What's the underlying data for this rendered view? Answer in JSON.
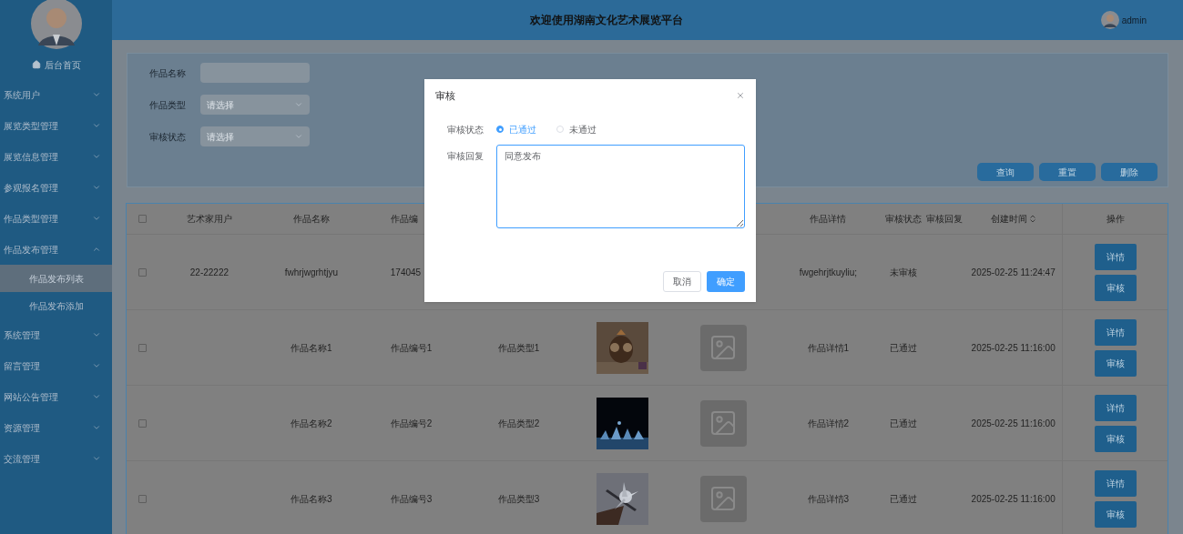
{
  "header": {
    "title": "欢迎使用湖南文化艺术展览平台",
    "user": "admin"
  },
  "sidebar": {
    "home": "后台首页",
    "items": [
      {
        "label": "系统用户",
        "expanded": false
      },
      {
        "label": "展览类型管理",
        "expanded": false
      },
      {
        "label": "展览信息管理",
        "expanded": false
      },
      {
        "label": "参观报名管理",
        "expanded": false
      },
      {
        "label": "作品类型管理",
        "expanded": false
      },
      {
        "label": "作品发布管理",
        "expanded": true,
        "children": [
          {
            "label": "作品发布列表",
            "selected": true
          },
          {
            "label": "作品发布添加",
            "selected": false
          }
        ]
      },
      {
        "label": "系统管理",
        "expanded": false
      },
      {
        "label": "留言管理",
        "expanded": false
      },
      {
        "label": "网站公告管理",
        "expanded": false
      },
      {
        "label": "资源管理",
        "expanded": false
      },
      {
        "label": "交流管理",
        "expanded": false
      }
    ]
  },
  "search": {
    "fields": [
      {
        "label": "作品名称",
        "kind": "text"
      },
      {
        "label": "作品类型",
        "kind": "select",
        "placeholder": "请选择"
      },
      {
        "label": "审核状态",
        "kind": "select",
        "placeholder": "请选择"
      }
    ],
    "buttons": [
      "查询",
      "重置",
      "删除"
    ]
  },
  "table": {
    "all_checked": false,
    "columns": [
      {
        "label": "艺术家用户"
      },
      {
        "label": "作品名称"
      },
      {
        "label": "作品编"
      },
      {},
      {},
      {},
      {
        "label": "作品详情"
      },
      {
        "label": "审核状态"
      },
      {
        "label": "审核回复"
      },
      {
        "label": "创建时间",
        "sortable": true
      },
      {
        "label": "操作"
      }
    ],
    "rows": [
      {
        "checked": false,
        "cells": [
          {
            "kind": "text",
            "text": "22-22222"
          },
          {
            "kind": "text",
            "text": "fwhrjwgrhtjyu"
          },
          {
            "kind": "text",
            "text": "174045"
          },
          {},
          {},
          {},
          {
            "kind": "text",
            "text": "fwgehrjtkuyliu;"
          },
          {
            "kind": "text",
            "text": "未审核"
          },
          {},
          {
            "kind": "text",
            "text": "2025-02-25 11:24:47"
          }
        ],
        "actions": [
          "详情",
          "审核"
        ]
      },
      {
        "checked": false,
        "cells": [
          {},
          {
            "kind": "text",
            "text": "作品名称1"
          },
          {
            "kind": "text",
            "text": "作品编号1"
          },
          {
            "kind": "text",
            "text": "作品类型1"
          },
          {
            "kind": "picture"
          },
          {
            "kind": "image-placeholder"
          },
          {
            "kind": "text",
            "text": "作品详情1"
          },
          {
            "kind": "text",
            "text": "已通过"
          },
          {},
          {
            "kind": "text",
            "text": "2025-02-25 11:16:00"
          }
        ],
        "actions": [
          "详情",
          "审核"
        ]
      },
      {
        "checked": false,
        "cells": [
          {},
          {
            "kind": "text",
            "text": "作品名称2"
          },
          {
            "kind": "text",
            "text": "作品编号2"
          },
          {
            "kind": "text",
            "text": "作品类型2"
          },
          {
            "kind": "picture"
          },
          {
            "kind": "image-placeholder"
          },
          {
            "kind": "text",
            "text": "作品详情2"
          },
          {
            "kind": "text",
            "text": "已通过"
          },
          {},
          {
            "kind": "text",
            "text": "2025-02-25 11:16:00"
          }
        ],
        "actions": [
          "详情",
          "审核"
        ]
      },
      {
        "checked": false,
        "cells": [
          {},
          {
            "kind": "text",
            "text": "作品名称3"
          },
          {
            "kind": "text",
            "text": "作品编号3"
          },
          {
            "kind": "text",
            "text": "作品类型3"
          },
          {
            "kind": "picture"
          },
          {
            "kind": "image-placeholder"
          },
          {
            "kind": "text",
            "text": "作品详情3"
          },
          {
            "kind": "text",
            "text": "已通过"
          },
          {},
          {
            "kind": "text",
            "text": "2025-02-25 11:16:00"
          }
        ],
        "actions": [
          "详情",
          "审核"
        ]
      }
    ]
  },
  "dialog": {
    "title": "审核",
    "status_label": "审核状态",
    "options": [
      {
        "label": "已通过",
        "selected": true
      },
      {
        "label": "未通过",
        "selected": false
      }
    ],
    "reply_label": "审核回复",
    "reply": "同意发布",
    "buttons": [
      {
        "label": "取消",
        "kind": "default"
      },
      {
        "label": "确定",
        "kind": "primary"
      }
    ]
  }
}
